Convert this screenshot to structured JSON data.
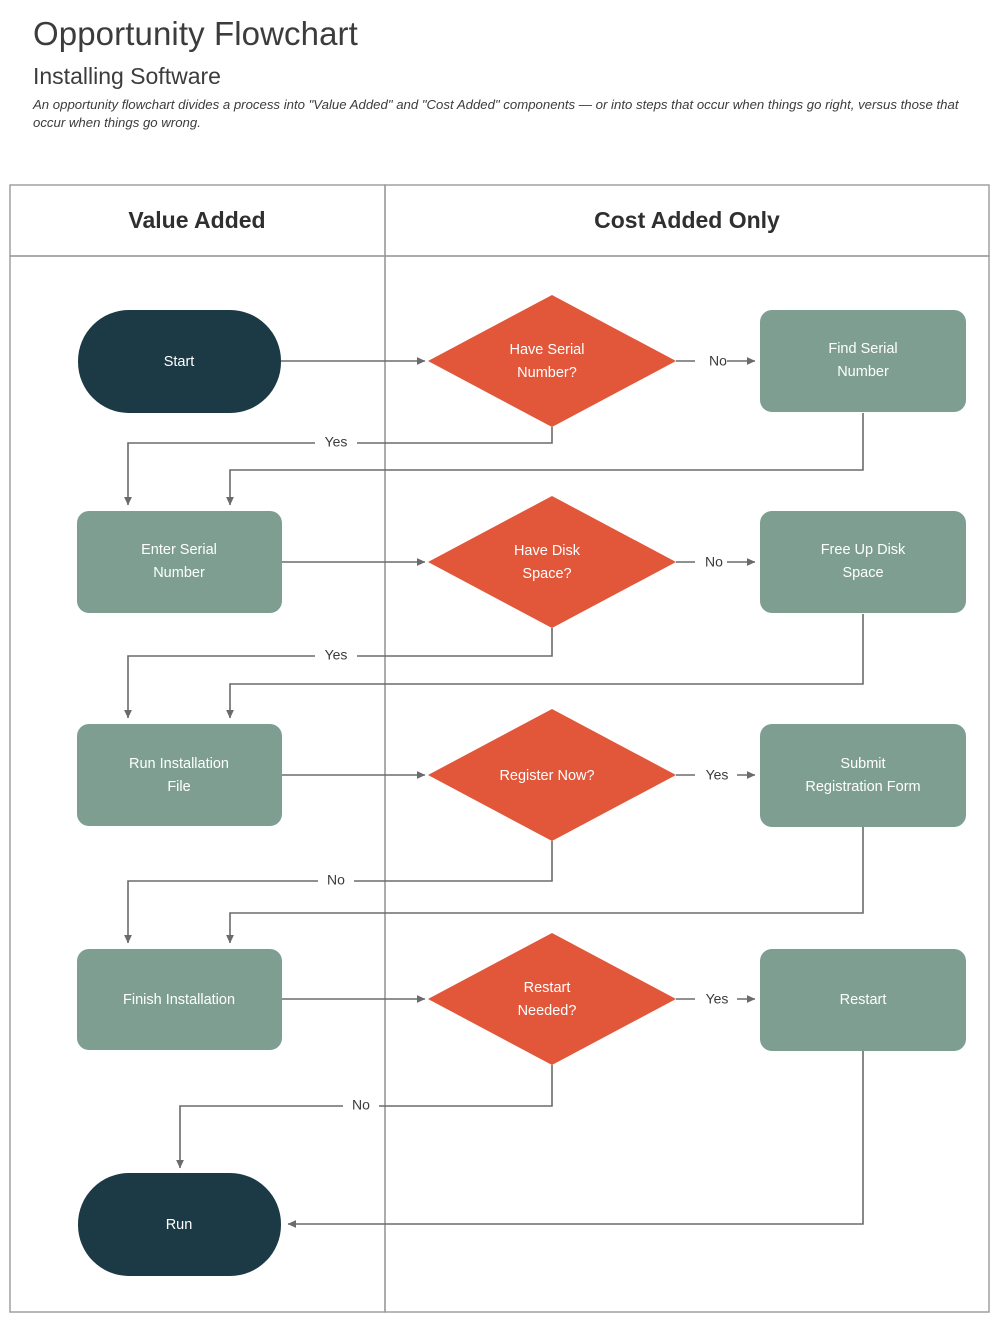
{
  "document": {
    "title": "Opportunity Flowchart",
    "subtitle": "Installing Software",
    "description": "An opportunity flowchart divides a process into \"Value Added\" and \"Cost Added\" components — or into steps that occur when things go right, versus those that occur when things go wrong."
  },
  "colors": {
    "terminator": "#1b3a45",
    "process": "#7d9e91",
    "decision": "#e2563a",
    "connector": "#6b6b6b",
    "lane_border": "#9a9a9a",
    "lane_header_bg": "#f7f7f7",
    "node_text": "#ffffff",
    "label_text": "#3b3b3b"
  },
  "lanes": [
    {
      "id": "value-added",
      "title": "Value Added"
    },
    {
      "id": "cost-added",
      "title": "Cost Added Only"
    }
  ],
  "chart_data": {
    "type": "flowchart",
    "nodes": [
      {
        "id": "start",
        "label": "Start",
        "shape": "terminator",
        "lane": "value-added"
      },
      {
        "id": "have-serial",
        "label": "Have Serial\nNumber?",
        "shape": "decision",
        "lane": "cost-added"
      },
      {
        "id": "find-serial",
        "label": "Find Serial\nNumber",
        "shape": "process",
        "lane": "cost-added"
      },
      {
        "id": "enter-serial",
        "label": "Enter Serial\nNumber",
        "shape": "process",
        "lane": "value-added"
      },
      {
        "id": "have-disk",
        "label": "Have Disk\nSpace?",
        "shape": "decision",
        "lane": "cost-added"
      },
      {
        "id": "free-disk",
        "label": "Free Up Disk\nSpace",
        "shape": "process",
        "lane": "cost-added"
      },
      {
        "id": "run-install",
        "label": "Run Installation\nFile",
        "shape": "process",
        "lane": "value-added"
      },
      {
        "id": "register-now",
        "label": "Register Now?",
        "shape": "decision",
        "lane": "cost-added"
      },
      {
        "id": "submit-reg",
        "label": "Submit\nRegistration Form",
        "shape": "process",
        "lane": "cost-added"
      },
      {
        "id": "finish-install",
        "label": "Finish Installation",
        "shape": "process",
        "lane": "value-added"
      },
      {
        "id": "restart-needed",
        "label": "Restart\nNeeded?",
        "shape": "decision",
        "lane": "cost-added"
      },
      {
        "id": "restart",
        "label": "Restart",
        "shape": "process",
        "lane": "cost-added"
      },
      {
        "id": "run",
        "label": "Run",
        "shape": "terminator",
        "lane": "value-added"
      }
    ],
    "edges": [
      {
        "from": "start",
        "to": "have-serial",
        "label": ""
      },
      {
        "from": "have-serial",
        "to": "find-serial",
        "label": "No"
      },
      {
        "from": "have-serial",
        "to": "enter-serial",
        "label": "Yes"
      },
      {
        "from": "find-serial",
        "to": "enter-serial",
        "label": ""
      },
      {
        "from": "enter-serial",
        "to": "have-disk",
        "label": ""
      },
      {
        "from": "have-disk",
        "to": "free-disk",
        "label": "No"
      },
      {
        "from": "have-disk",
        "to": "run-install",
        "label": "Yes"
      },
      {
        "from": "free-disk",
        "to": "run-install",
        "label": ""
      },
      {
        "from": "run-install",
        "to": "register-now",
        "label": ""
      },
      {
        "from": "register-now",
        "to": "submit-reg",
        "label": "Yes"
      },
      {
        "from": "register-now",
        "to": "finish-install",
        "label": "No"
      },
      {
        "from": "submit-reg",
        "to": "finish-install",
        "label": ""
      },
      {
        "from": "finish-install",
        "to": "restart-needed",
        "label": ""
      },
      {
        "from": "restart-needed",
        "to": "restart",
        "label": "Yes"
      },
      {
        "from": "restart-needed",
        "to": "run",
        "label": "No"
      },
      {
        "from": "restart",
        "to": "run",
        "label": ""
      }
    ],
    "edge_labels": [
      "No",
      "Yes",
      "No",
      "Yes",
      "Yes",
      "No",
      "Yes",
      "No"
    ]
  }
}
